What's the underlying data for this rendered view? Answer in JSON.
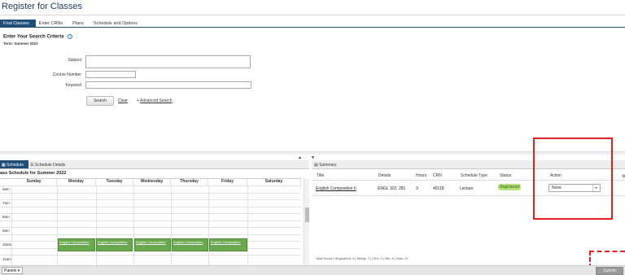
{
  "page": {
    "title": "Register for Classes"
  },
  "tabs": [
    "Find Classes",
    "Enter CRNs",
    "Plans",
    "Schedule and Options"
  ],
  "search": {
    "heading": "Enter Your Search Criteria",
    "term": "Term: Summer 2022",
    "subject_label": "Subject",
    "course_number_label": "Course Number",
    "keyword_label": "Keyword",
    "search_button": "Search",
    "clear_link": "Clear",
    "advanced_link": "Advanced Search"
  },
  "schedule_panel": {
    "tabs": [
      "Schedule",
      "Schedule Details"
    ],
    "title": "ass Schedule for Summer 2022",
    "days": [
      "Sunday",
      "Monday",
      "Tuesday",
      "Wednesday",
      "Thursday",
      "Friday",
      "Saturday"
    ],
    "times": [
      "6am",
      "7am",
      "8am",
      "9am",
      "10am",
      "11am"
    ],
    "event_label": "English Composition"
  },
  "summary_panel": {
    "title": "Summary",
    "columns": [
      "Title",
      "Details",
      "Hours",
      "CRN",
      "Schedule Type",
      "Status",
      "Action"
    ],
    "row": {
      "title": "English Composition II",
      "details": "ENGL 102, 281",
      "hours": "3",
      "crn": "40118",
      "schedule_type": "Lecture",
      "status": "Registered",
      "action": "None"
    },
    "totals": "Total Hours | Registered: 3 | Billing: 3 | CEU: 0 | Min: 0 | Max: 12"
  },
  "footer": {
    "panels_label": "Panels",
    "submit_label": "Submit"
  },
  "colors": {
    "accent": "#1f4e79",
    "event_green": "#6aa84f",
    "status_green": "#b6e07a",
    "highlight_red": "#e02020"
  }
}
